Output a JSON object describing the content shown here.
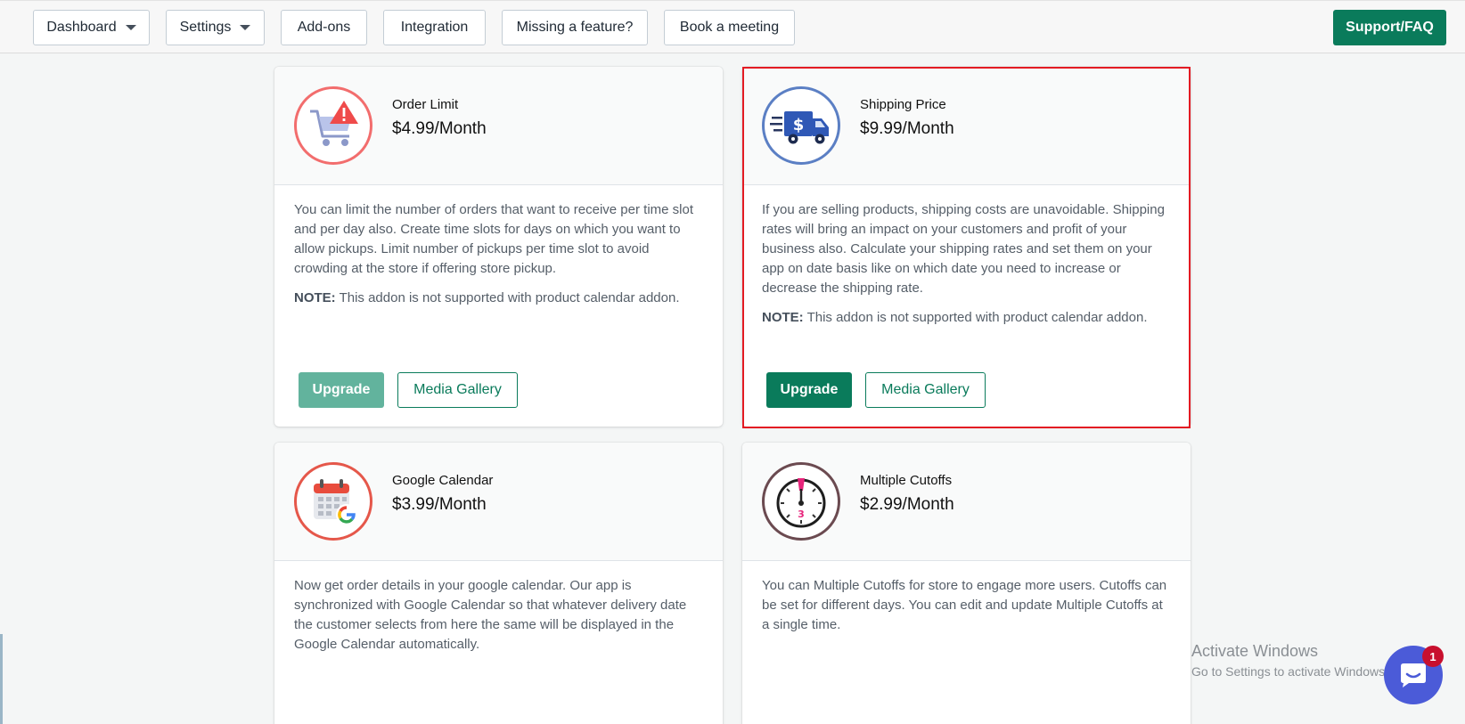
{
  "nav": {
    "dashboard": "Dashboard",
    "settings": "Settings",
    "addons": "Add-ons",
    "integration": "Integration",
    "missing_feature": "Missing a feature?",
    "book_meeting": "Book a meeting",
    "support": "Support/FAQ"
  },
  "cards": [
    {
      "title": "Order Limit",
      "price": "$4.99/Month",
      "description": "You can limit the number of orders that want to receive per time slot and per day also. Create time slots for days on which you want to allow pickups. Limit number of pickups per time slot to avoid crowding at the store if offering store pickup.",
      "note_label": "NOTE:",
      "note_text": " This addon is not supported with product calendar addon.",
      "upgrade_label": "Upgrade",
      "media_label": "Media Gallery",
      "icon": "cart-warning-icon"
    },
    {
      "title": "Shipping Price",
      "price": "$9.99/Month",
      "description": "If you are selling products, shipping costs are unavoidable. Shipping rates will bring an impact on your customers and profit of your business also. Calculate your shipping rates and set them on your app on date basis like on which date you need to increase or decrease the shipping rate.",
      "note_label": "NOTE:",
      "note_text": " This addon is not supported with product calendar addon.",
      "upgrade_label": "Upgrade",
      "media_label": "Media Gallery",
      "icon": "delivery-truck-icon"
    },
    {
      "title": "Google Calendar",
      "price": "$3.99/Month",
      "description": "Now get order details in your google calendar. Our app is synchronized with Google Calendar so that whatever delivery date the customer selects from here the same will be displayed in the Google Calendar automatically.",
      "icon": "google-calendar-icon"
    },
    {
      "title": "Multiple Cutoffs",
      "price": "$2.99/Month",
      "description": "You can Multiple Cutoffs for store to engage more users. Cutoffs can be set for different days. You can edit and update Multiple Cutoffs at a single time.",
      "icon": "stopwatch-icon"
    }
  ],
  "watermark": {
    "title": "Activate Windows",
    "subtitle": "Go to Settings to activate Windows."
  },
  "chat": {
    "badge": "1"
  },
  "colors": {
    "primary": "#0a7b5b",
    "primary_disabled": "#62b39d",
    "highlight": "#e31b23"
  }
}
